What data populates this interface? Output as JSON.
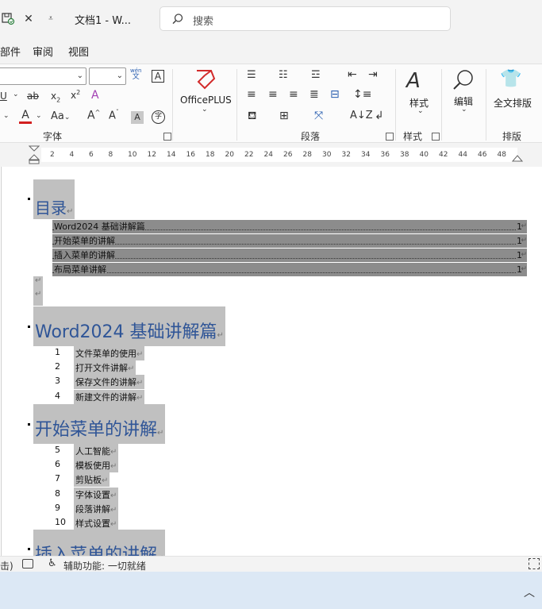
{
  "titlebar": {
    "doc_title": "文档1  -  W...",
    "search_placeholder": "搜索",
    "icons": [
      "save-icon",
      "close-icon",
      "customize-qat-icon"
    ]
  },
  "menu": {
    "items": [
      "部件",
      "审阅",
      "视图"
    ]
  },
  "ribbon": {
    "font_group": {
      "label": "字体",
      "phonetic_top": "wén",
      "phonetic_bottom": "文",
      "aa_label": "Aa",
      "char_border": "A"
    },
    "officeplus": {
      "label": "OfficePLUS"
    },
    "paragraph_group": {
      "label": "段落"
    },
    "styles_group": {
      "label": "样式",
      "button_label": "样式"
    },
    "edit": {
      "label": "编辑"
    },
    "layout_group": {
      "label": "排版",
      "button_label": "全文排版"
    }
  },
  "ruler": {
    "ticks": [
      "2",
      "4",
      "6",
      "8",
      "10",
      "12",
      "14",
      "16",
      "18",
      "20",
      "22",
      "24",
      "26",
      "28",
      "30",
      "32",
      "34",
      "36",
      "38",
      "40",
      "42",
      "44",
      "46",
      "48"
    ]
  },
  "document": {
    "toc_heading": "目录",
    "toc_entries": [
      {
        "text": "Word2024 基础讲解篇",
        "page": "1"
      },
      {
        "text": "开始菜单的讲解",
        "page": "1"
      },
      {
        "text": "插入菜单的讲解",
        "page": "1"
      },
      {
        "text": "布局菜单讲解",
        "page": "1"
      }
    ],
    "para_mark": "↵",
    "sections": [
      {
        "heading": "Word2024 基础讲解篇",
        "items": [
          {
            "num": "1",
            "text": "文件菜单的使用"
          },
          {
            "num": "2",
            "text": "打开文件讲解"
          },
          {
            "num": "3",
            "text": "保存文件的讲解"
          },
          {
            "num": "4",
            "text": "新建文件的讲解"
          }
        ]
      },
      {
        "heading": "开始菜单的讲解",
        "items": [
          {
            "num": "5",
            "text": "人工智能"
          },
          {
            "num": "6",
            "text": "模板使用"
          },
          {
            "num": "7",
            "text": "剪贴板"
          },
          {
            "num": "8",
            "text": "字体设置"
          },
          {
            "num": "9",
            "text": "段落讲解"
          },
          {
            "num": "10",
            "text": "样式设置"
          }
        ]
      },
      {
        "heading": "插入菜单的讲解",
        "items": []
      }
    ]
  },
  "statusbar": {
    "left_fragment": "击)",
    "accessibility": "辅助功能: 一切就绪"
  }
}
